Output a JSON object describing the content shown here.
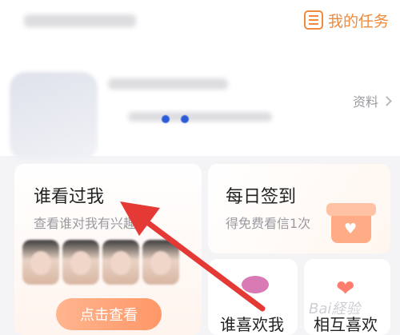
{
  "header": {
    "my_tasks_label": "我的任务",
    "accent_color": "#f08a3c"
  },
  "profile": {
    "profile_label": "资料"
  },
  "cards": {
    "who_viewed_me": {
      "title": "谁看过我",
      "subtitle": "查看谁对我有兴趣",
      "button_label": "点击查看"
    },
    "daily_checkin": {
      "title": "每日签到",
      "subtitle": "得免费看信1次"
    },
    "who_likes_me": {
      "title": "谁喜欢我"
    },
    "mutual_like": {
      "title": "相互喜欢"
    }
  },
  "annotation": {
    "arrow_color": "#e53935"
  },
  "watermark": {
    "text": "Bai経验"
  }
}
